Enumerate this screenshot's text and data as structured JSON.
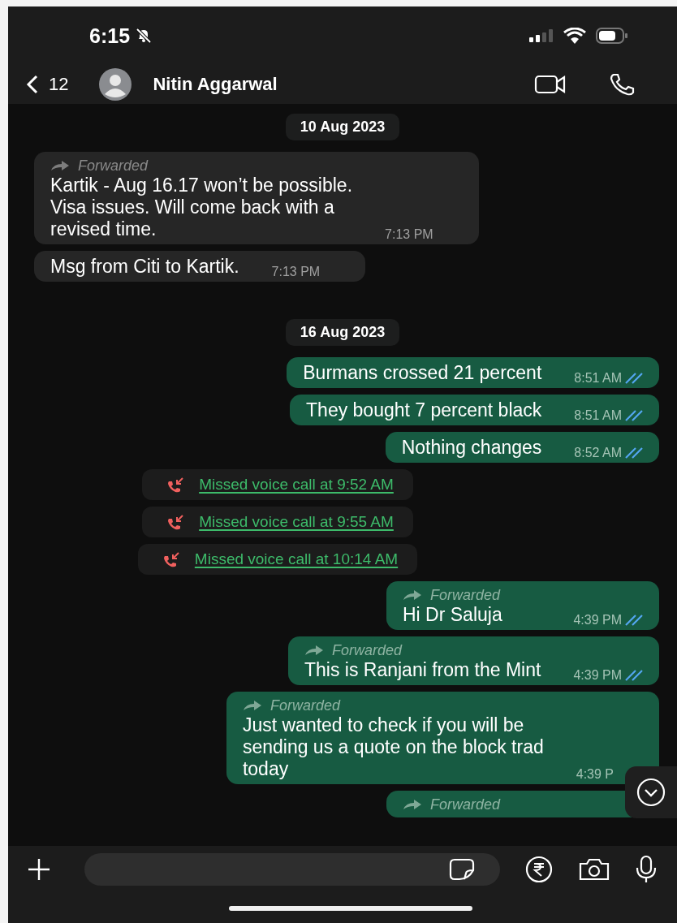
{
  "status_bar": {
    "time": "6:15",
    "muted": true
  },
  "header": {
    "back_count": "12",
    "contact": "Nitin Aggarwal"
  },
  "messages": [
    {
      "kind": "date",
      "text": "10 Aug 2023"
    },
    {
      "kind": "incoming",
      "forward_label": "Forwarded",
      "text": "Kartik - Aug 16.17 won’t be possible.\nVisa issues. Will come back with a\nrevised time.",
      "time": "7:13 PM"
    },
    {
      "kind": "incoming",
      "text": "Msg from Citi to Kartik.",
      "time": "7:13 PM"
    },
    {
      "kind": "date",
      "text": "16 Aug 2023"
    },
    {
      "kind": "outgoing",
      "text": "Burmans crossed 21 percent",
      "time": "8:51 AM",
      "read": true
    },
    {
      "kind": "outgoing",
      "text": "They bought 7 percent black",
      "time": "8:51 AM",
      "read": true
    },
    {
      "kind": "outgoing",
      "text": "Nothing changes",
      "time": "8:52 AM",
      "read": true
    },
    {
      "kind": "call",
      "text": "Missed voice call at 9:52 AM"
    },
    {
      "kind": "call",
      "text": "Missed voice call at 9:55 AM"
    },
    {
      "kind": "call",
      "text": "Missed voice call at 10:14 AM"
    },
    {
      "kind": "outgoing",
      "forward_label": "Forwarded",
      "text": "Hi Dr Saluja",
      "time": "4:39 PM",
      "read": true
    },
    {
      "kind": "outgoing",
      "forward_label": "Forwarded",
      "text": "This is Ranjani from the Mint",
      "time": "4:39 PM",
      "read": true
    },
    {
      "kind": "outgoing",
      "forward_label": "Forwarded",
      "text": "Just wanted to check if you will be\nsending us a quote on the block trad\ntoday",
      "time": "4:39 P"
    },
    {
      "kind": "outgoing",
      "forward_label": "Forwarded"
    }
  ]
}
